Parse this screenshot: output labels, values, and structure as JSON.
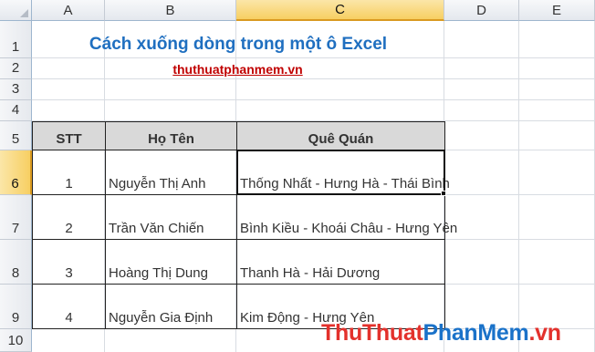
{
  "columns": [
    {
      "label": "A",
      "selected": false
    },
    {
      "label": "B",
      "selected": false
    },
    {
      "label": "C",
      "selected": true
    },
    {
      "label": "D",
      "selected": false
    },
    {
      "label": "E",
      "selected": false
    }
  ],
  "rows": [
    {
      "label": "1",
      "selected": false
    },
    {
      "label": "2",
      "selected": false
    },
    {
      "label": "3",
      "selected": false
    },
    {
      "label": "4",
      "selected": false
    },
    {
      "label": "5",
      "selected": false
    },
    {
      "label": "6",
      "selected": true
    },
    {
      "label": "7",
      "selected": false
    },
    {
      "label": "8",
      "selected": false
    },
    {
      "label": "9",
      "selected": false
    },
    {
      "label": "10",
      "selected": false
    }
  ],
  "sheet": {
    "title": "Cách xuống dòng trong một ô Excel",
    "link": "thuthuatphanmem.vn"
  },
  "table": {
    "headers": [
      "STT",
      "Họ Tên",
      "Quê Quán"
    ],
    "rows": [
      [
        "1",
        "Nguyễn Thị Anh",
        "Thống Nhất - Hưng Hà - Thái Bình"
      ],
      [
        "2",
        "Trần Văn Chiến",
        "Bình Kiều - Khoái Châu - Hưng Yên"
      ],
      [
        "3",
        "Hoàng Thị Dung",
        "Thanh Hà - Hải Dương"
      ],
      [
        "4",
        "Nguyễn Gia Định",
        "Kim Động - Hưng Yên"
      ]
    ]
  },
  "watermark": {
    "part1": "Thu",
    "part2": "Thuat",
    "part3": "PhanMem",
    "part4": ".vn"
  },
  "colors": {
    "title": "#1f6fc0",
    "link": "#c00000",
    "header_fill": "#d9d9d9",
    "selected_header": "#f7cf62",
    "watermark_red": "#e3312c",
    "watermark_blue": "#1a72c9"
  }
}
